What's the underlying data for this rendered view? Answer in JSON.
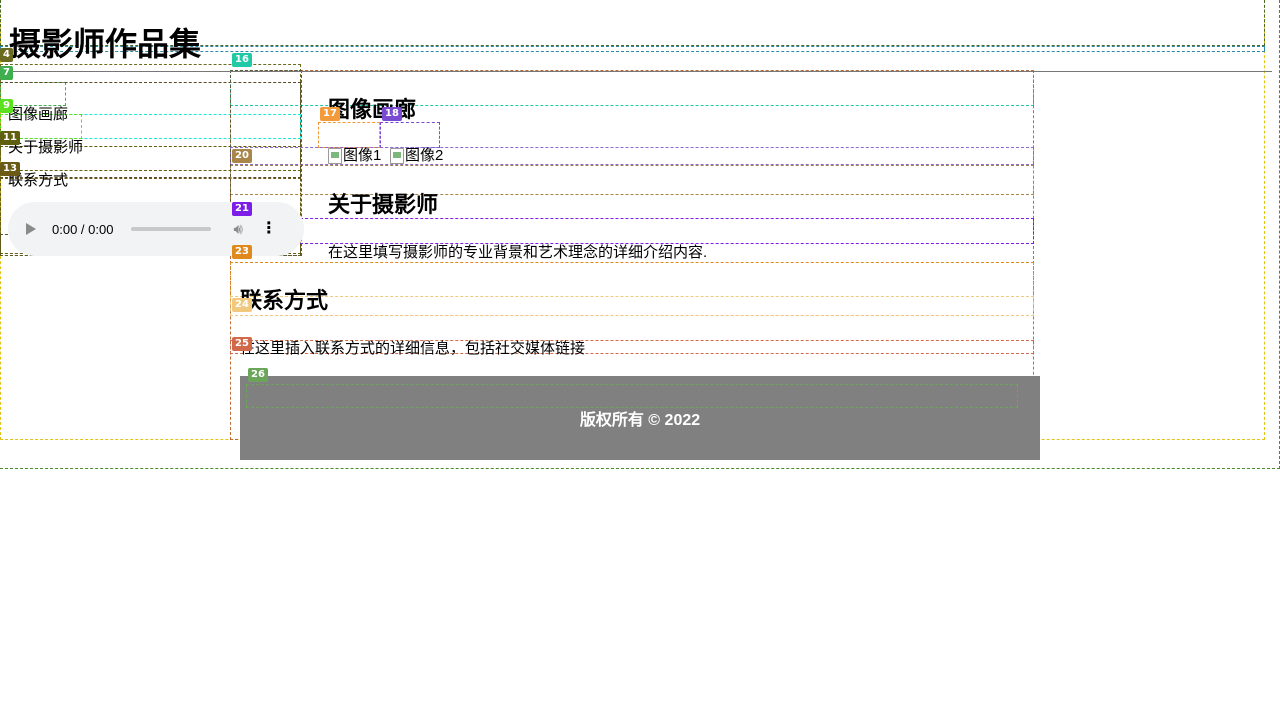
{
  "header": {
    "title": "摄影师作品集"
  },
  "nav": {
    "items": [
      {
        "label": "图像画廊"
      },
      {
        "label": "关于摄影师"
      },
      {
        "label": "联系方式"
      }
    ]
  },
  "audio": {
    "time": "0:00 / 0:00"
  },
  "gallery": {
    "heading": "图像画廊",
    "images": [
      {
        "alt": "图像1"
      },
      {
        "alt": "图像2"
      }
    ]
  },
  "about": {
    "heading": "关于摄影师",
    "text": "在这里填写摄影师的专业背景和艺术理念的详细介绍内容."
  },
  "contact": {
    "heading": "联系方式",
    "text": "在这里插入联系方式的详细信息，包括社交媒体链接"
  },
  "footer": {
    "text": "版权所有 © 2022"
  },
  "overlay_labels": [
    "4",
    "7",
    "9",
    "11",
    "13",
    "16",
    "17",
    "18",
    "20",
    "21",
    "23",
    "24",
    "25",
    "26"
  ],
  "overlay_colors": {
    "4": "#6b6b1f",
    "7": "#3fae4f",
    "9": "#5be21e",
    "11": "#5f5f0e",
    "13": "#6b5a14",
    "16": "#21c9a4",
    "17": "#f39a3a",
    "18": "#7a4ad0",
    "20": "#a8854b",
    "21": "#7d1ee8",
    "23": "#e08a1e",
    "24": "#f1c97e",
    "25": "#d06a4a",
    "26": "#6aa55a"
  }
}
